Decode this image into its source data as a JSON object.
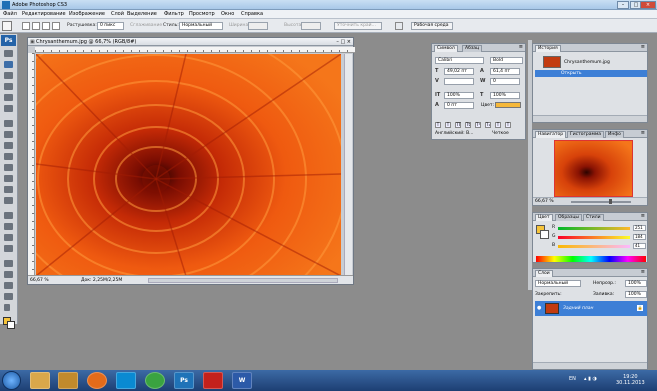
{
  "window": {
    "title": "Adobe Photoshop CS3"
  },
  "menu": [
    "Файл",
    "Редактирование",
    "Изображение",
    "Слой",
    "Выделение",
    "Фильтр",
    "Просмотр",
    "Окно",
    "Справка"
  ],
  "options": {
    "feather_label": "Растушевка:",
    "feather_value": "0 пикс",
    "antialias_label": "Сглаживание",
    "style_label": "Стиль:",
    "style_value": "Нормальный",
    "width_label": "Ширина:",
    "height_label": "Высота:",
    "refine_edge": "Уточнить край...",
    "workspace_label": "Рабочая среда"
  },
  "tools": {
    "logo": "Ps",
    "fg_color": "#f6c43a",
    "bg_color": "#ffffff"
  },
  "document": {
    "tab_title": "Chrysanthemum.jpg @ 66,7% (RGB/8#)",
    "zoom": "66,67 %",
    "doc_info": "Док: 2,25M/2,25M"
  },
  "character": {
    "tabs": [
      "Символ",
      "Абзац"
    ],
    "font_family": "Calibri",
    "font_style": "Bold",
    "size": "49,02 пт",
    "leading": "61,4 пт",
    "kerning": "",
    "tracking": "0",
    "vscale": "100%",
    "hscale": "100%",
    "baseline": "0 пт",
    "color_label": "Цвет:",
    "language": "Английский: В...",
    "antialias": "Четкое",
    "text_color": "#f6b83a"
  },
  "history": {
    "tab": "История",
    "snapshot_name": "Chrysanthemum.jpg",
    "state": "Открыть"
  },
  "navigator": {
    "tabs": [
      "Навигатор",
      "Гистограмма",
      "Инфо"
    ],
    "zoom": "66,67 %"
  },
  "color": {
    "tabs": [
      "Цвет",
      "Образцы",
      "Стили"
    ],
    "channels": [
      {
        "name": "R",
        "value": "251"
      },
      {
        "name": "G",
        "value": "184"
      },
      {
        "name": "B",
        "value": "41"
      }
    ]
  },
  "layers": {
    "tab": "Слои",
    "blend_mode": "Нормальный",
    "opacity_label": "Непрозр.:",
    "opacity": "100%",
    "lock_label": "Закрепить:",
    "fill_label": "Заливка:",
    "fill": "100%",
    "layer_name": "Задний план"
  },
  "taskbar": {
    "apps": [
      "",
      "",
      "",
      "",
      "",
      "",
      "Ps",
      "",
      "W"
    ],
    "lang": "EN",
    "time": "19:20",
    "date": "30.11.2013"
  }
}
